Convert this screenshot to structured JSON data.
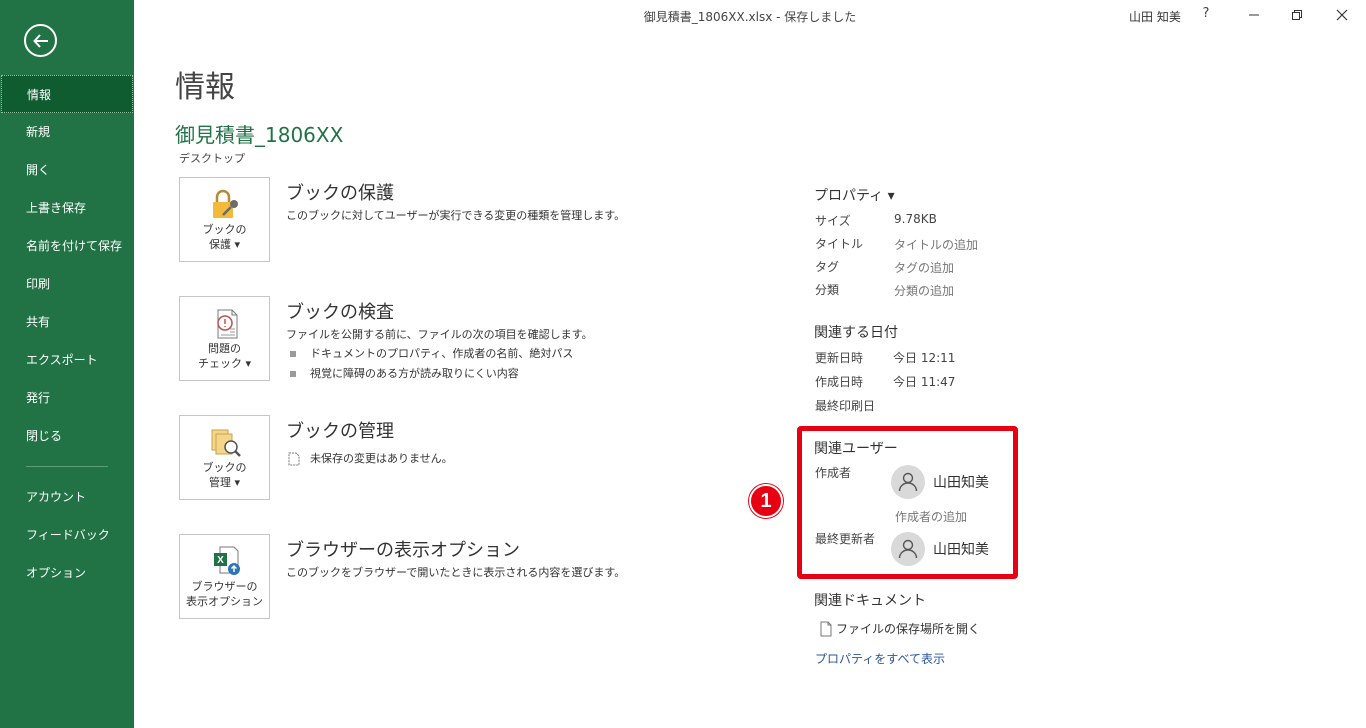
{
  "titlebar": {
    "doc_title": "御見積書_1806XX.xlsx  -  保存しました",
    "user": "山田 知美",
    "help": "?"
  },
  "sidebar": {
    "items": [
      {
        "label": "情報"
      },
      {
        "label": "新規"
      },
      {
        "label": "開く"
      },
      {
        "label": "上書き保存"
      },
      {
        "label": "名前を付けて保存"
      },
      {
        "label": "印刷"
      },
      {
        "label": "共有"
      },
      {
        "label": "エクスポート"
      },
      {
        "label": "発行"
      },
      {
        "label": "閉じる"
      }
    ],
    "bottom_items": [
      {
        "label": "アカウント"
      },
      {
        "label": "フィードバック"
      },
      {
        "label": "オプション"
      }
    ]
  },
  "main": {
    "title": "情報",
    "file_name": "御見積書_1806XX",
    "location": "デスクトップ",
    "sections": [
      {
        "tile_line1": "ブックの",
        "tile_line2": "保護 ▾",
        "heading": "ブックの保護",
        "desc": "このブックに対してユーザーが実行できる変更の種類を管理します。"
      },
      {
        "tile_line1": "問題の",
        "tile_line2": "チェック ▾",
        "heading": "ブックの検査",
        "desc": "ファイルを公開する前に、ファイルの次の項目を確認します。",
        "bullets": [
          "ドキュメントのプロパティ、作成者の名前、絶対パス",
          "視覚に障碍のある方が読み取りにくい内容"
        ]
      },
      {
        "tile_line1": "ブックの",
        "tile_line2": "管理 ▾",
        "heading": "ブックの管理",
        "status": "未保存の変更はありません。"
      },
      {
        "tile_line1": "ブラウザーの",
        "tile_line2": "表示オプション",
        "heading": "ブラウザーの表示オプション",
        "desc": "このブックをブラウザーで開いたときに表示される内容を選びます。"
      }
    ]
  },
  "properties": {
    "title": "プロパティ ▾",
    "rows": [
      {
        "label": "サイズ",
        "value": "9.78KB"
      },
      {
        "label": "タイトル",
        "value": "タイトルの追加"
      },
      {
        "label": "タグ",
        "value": "タグの追加"
      },
      {
        "label": "分類",
        "value": "分類の追加"
      }
    ],
    "dates_title": "関連する日付",
    "dates": [
      {
        "label": "更新日時",
        "value": "今日 12:11"
      },
      {
        "label": "作成日時",
        "value": "今日 11:47"
      },
      {
        "label": "最終印刷日",
        "value": ""
      }
    ],
    "users_title": "関連ユーザー",
    "author_label": "作成者",
    "author_name": "山田知美",
    "add_author": "作成者の追加",
    "modifier_label": "最終更新者",
    "modifier_name": "山田知美",
    "docs_title": "関連ドキュメント",
    "open_location": "ファイルの保存場所を開く",
    "show_all": "プロパティをすべて表示"
  },
  "annotation": {
    "badge": "1"
  },
  "colors": {
    "accent": "#217346",
    "highlight": "#e60012",
    "link": "#2b579a"
  }
}
